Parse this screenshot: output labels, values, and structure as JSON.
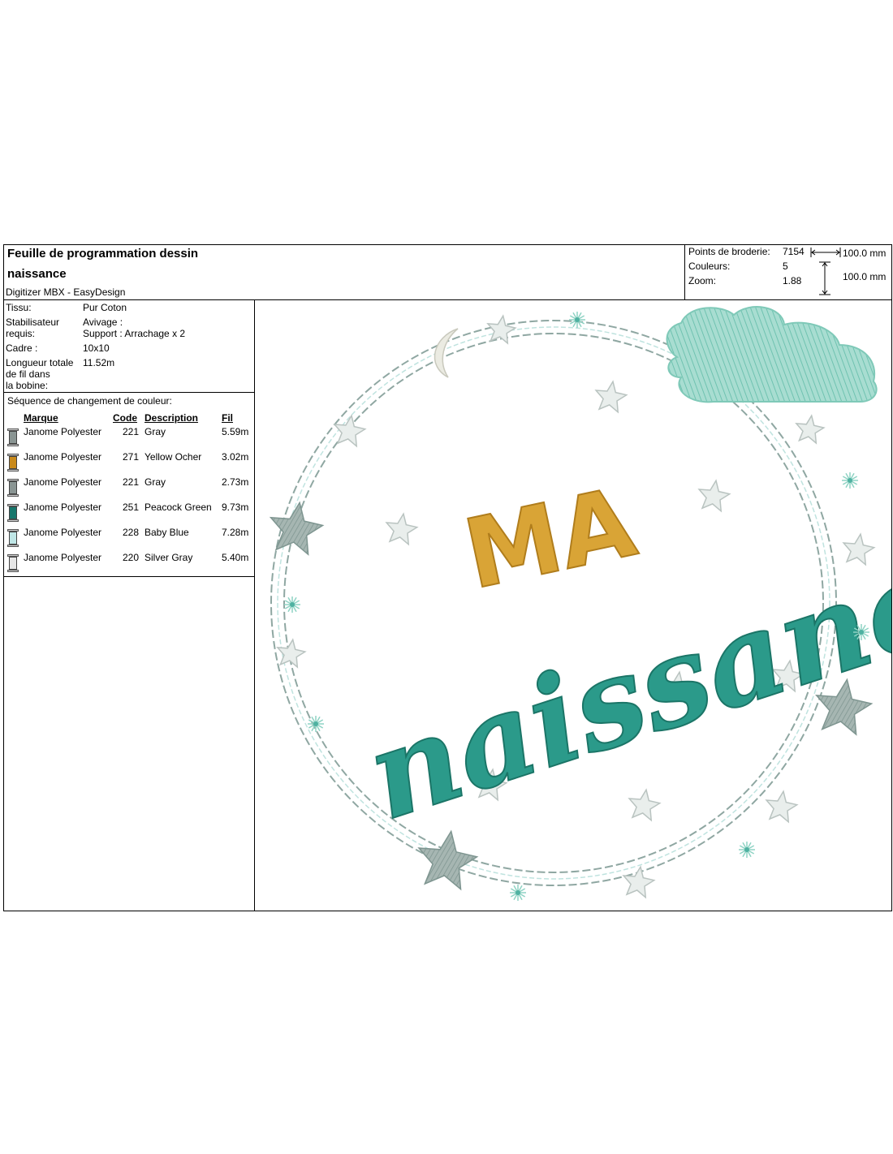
{
  "header": {
    "title_line1": "Feuille de programmation dessin",
    "title_line2": "naissance",
    "software": "Digitizer MBX - EasyDesign"
  },
  "stats": {
    "stitches_label": "Points de broderie:",
    "stitches_value": "7154",
    "colors_label": "Couleurs:",
    "colors_value": "5",
    "zoom_label": "Zoom:",
    "zoom_value": "1.88",
    "width_value": "100.0 mm",
    "height_value": "100.0 mm"
  },
  "meta": {
    "fabric_label": "Tissu:",
    "fabric_value": "Pur Coton",
    "stabilizer_label_1": "Stabilisateur",
    "stabilizer_label_2": "requis:",
    "stabilizer_value_1": "Avivage :",
    "stabilizer_value_2": "Support : Arrachage x 2",
    "frame_label": "Cadre :",
    "frame_value": "10x10",
    "thread_label_1": "Longueur totale",
    "thread_label_2": "de fil dans",
    "thread_label_3": "la bobine:",
    "thread_value": "11.52m"
  },
  "sequence": {
    "title": "Séquence de changement de couleur:",
    "headers": {
      "brand": "Marque",
      "code": "Code",
      "description": "Description",
      "thread": "Fil"
    },
    "rows": [
      {
        "brand": "Janome Polyester",
        "code": "221",
        "description": "Gray",
        "thread": "5.59m",
        "color": "#8a9593"
      },
      {
        "brand": "Janome Polyester",
        "code": "271",
        "description": "Yellow Ocher",
        "thread": "3.02m",
        "color": "#c98a1b"
      },
      {
        "brand": "Janome Polyester",
        "code": "221",
        "description": "Gray",
        "thread": "2.73m",
        "color": "#8a9593"
      },
      {
        "brand": "Janome Polyester",
        "code": "251",
        "description": "Peacock Green",
        "thread": "9.73m",
        "color": "#17776c"
      },
      {
        "brand": "Janome Polyester",
        "code": "228",
        "description": "Baby Blue",
        "thread": "7.28m",
        "color": "#bfe6e6"
      },
      {
        "brand": "Janome Polyester",
        "code": "220",
        "description": "Silver Gray",
        "thread": "5.40m",
        "color": "#e6e6e6"
      }
    ]
  },
  "design": {
    "text_line1": "MA",
    "text_line2": "naissance",
    "colors": {
      "ring": "#8fa7a2",
      "ring_light": "#bfe3df",
      "mint": "#8fd3c4",
      "teal": "#2b9a8a",
      "ocher": "#d9a436",
      "star_gray": "#93a8a4",
      "star_white": "#e9eeec",
      "moon": "#ebebe2"
    }
  }
}
